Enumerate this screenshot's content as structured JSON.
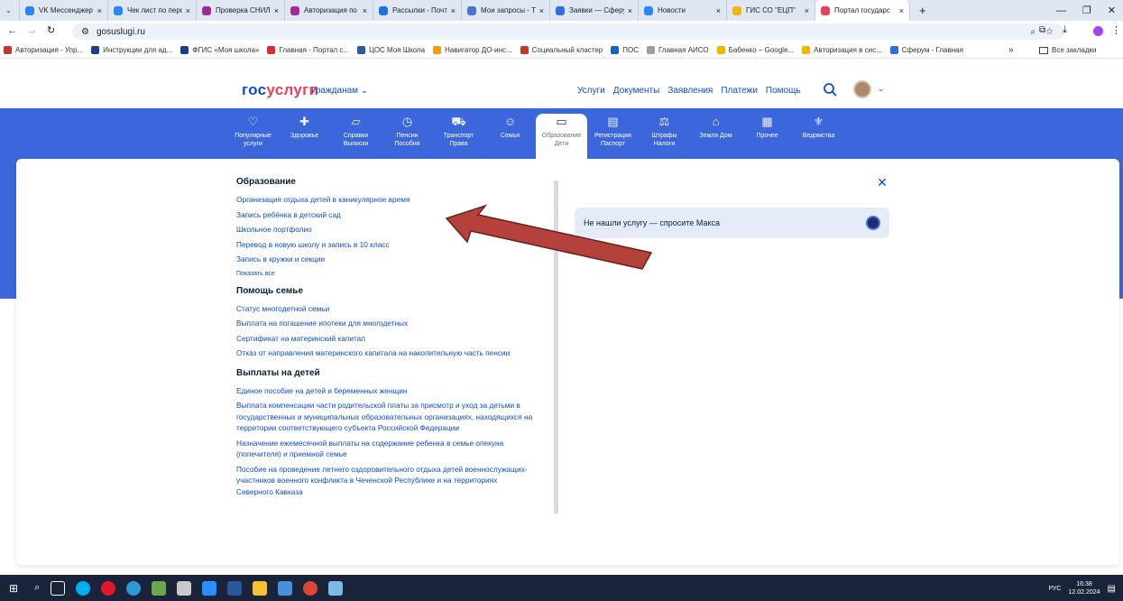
{
  "browser": {
    "tabs": [
      {
        "label": "VK Мессенджер",
        "color": "#2787f5"
      },
      {
        "label": "Чек лист по перс",
        "color": "#2787f5"
      },
      {
        "label": "Проверка СНИЛ",
        "color": "#a3279a"
      },
      {
        "label": "Авторизация по",
        "color": "#a3279a"
      },
      {
        "label": "Рассылки - Почт",
        "color": "#1a73e8"
      },
      {
        "label": "Мои запросы - Т",
        "color": "#4a73d8"
      },
      {
        "label": "Заявки — Сферу",
        "color": "#2f6fe4"
      },
      {
        "label": "Новости",
        "color": "#2787f5"
      },
      {
        "label": "ГИС СО \"ЕЦП\"",
        "color": "#f4b400"
      },
      {
        "label": "Портал государс",
        "color": "#ee3f58"
      }
    ],
    "tab_close": "×",
    "new_tab": "+",
    "win_min": "—",
    "win_max": "❐",
    "win_close": "✕",
    "url": "gosuslugi.ru",
    "bookmarks": [
      {
        "label": "Авторизация - Упр...",
        "color": "#c0392b"
      },
      {
        "label": "Инструкции для ад...",
        "color": "#1f3c88"
      },
      {
        "label": "ФГИС «Моя школа»",
        "color": "#1f3c88"
      },
      {
        "label": "Главная - Портал с...",
        "color": "#d32f2f"
      },
      {
        "label": "ЦОС Моя Школа",
        "color": "#2c5aa0"
      },
      {
        "label": "Навигатор ДО-инс...",
        "color": "#f39c12"
      },
      {
        "label": "Социальный кластер",
        "color": "#c0392b"
      },
      {
        "label": "ПОС",
        "color": "#1565c0"
      },
      {
        "label": "Главная АИСО",
        "color": "#9e9e9e"
      },
      {
        "label": "Бабенко – Google...",
        "color": "#f4b400"
      },
      {
        "label": "Авторизация в сис...",
        "color": "#f4b400"
      },
      {
        "label": "Сферум - Главная",
        "color": "#2f6fe4"
      }
    ],
    "bookmarks_more": "»",
    "all_bookmarks": "Все закладки"
  },
  "header": {
    "logo_a": "гос",
    "logo_b": "услуги",
    "citizens": "Гражданам ⌄",
    "nav": [
      "Услуги",
      "Документы",
      "Заявления",
      "Платежи",
      "Помощь"
    ]
  },
  "categories": [
    {
      "l1": "Популярные",
      "l2": "услуги",
      "icon": "♡",
      "name": "popular"
    },
    {
      "l1": "Здоровье",
      "l2": "",
      "icon": "✚",
      "name": "health"
    },
    {
      "l1": "Справки",
      "l2": "Выписки",
      "icon": "▱",
      "name": "certificates"
    },
    {
      "l1": "Пенсии",
      "l2": "Пособия",
      "icon": "◷",
      "name": "pensions"
    },
    {
      "l1": "Транспорт",
      "l2": "Права",
      "icon": "⛟",
      "name": "transport"
    },
    {
      "l1": "Семья",
      "l2": "",
      "icon": "☺",
      "name": "family"
    },
    {
      "l1": "Образование",
      "l2": "Дети",
      "icon": "▭",
      "name": "education"
    },
    {
      "l1": "Регистрация",
      "l2": "Паспорт",
      "icon": "▤",
      "name": "registration"
    },
    {
      "l1": "Штрафы",
      "l2": "Налоги",
      "icon": "⚖",
      "name": "fines"
    },
    {
      "l1": "Земля Дом",
      "l2": "",
      "icon": "⌂",
      "name": "land"
    },
    {
      "l1": "Прочее",
      "l2": "",
      "icon": "▦",
      "name": "other"
    },
    {
      "l1": "Ведомства",
      "l2": "",
      "icon": "⚜",
      "name": "agencies"
    }
  ],
  "sections": {
    "education": {
      "title": "Образование",
      "items": [
        "Организация отдыха детей в каникулярное время",
        "Запись ребёнка в детский сад",
        "Школьное портфолио",
        "Перевод в новую школу и запись в 10 класс",
        "Запись в кружки и секции"
      ],
      "show_all": "Показать все"
    },
    "family": {
      "title": "Помощь семье",
      "items": [
        "Статус многодетной семьи",
        "Выплата на погашение ипотеки для многодетных",
        "Сертификат на материнский капитал",
        "Отказ от направления материнского капитала на накопительную часть пенсии"
      ]
    },
    "payments": {
      "title": "Выплаты на детей",
      "items": [
        "Единое пособие на детей и беременных женщин",
        "Выплата компенсации части родительской платы за присмотр и уход за детьми в государственных и муниципальных образовательных организациях, находящихся на территории соответствующего субъекта Российской Федерации",
        "Назначение ежемесячной выплаты на содержание ребенка в семье опекуна (попечителя) и приемной семье",
        "Пособие на проведение летнего оздоровительного отдыха детей военнослужащих-участников военного конфликта в Чеченской Республике и на территориях Северного Кавказа"
      ]
    }
  },
  "ask": "Не нашли услугу — спросите Макса",
  "close": "✕",
  "taskbar": {
    "lang": "РУС",
    "time": "16:38",
    "date": "12.02.2024"
  }
}
